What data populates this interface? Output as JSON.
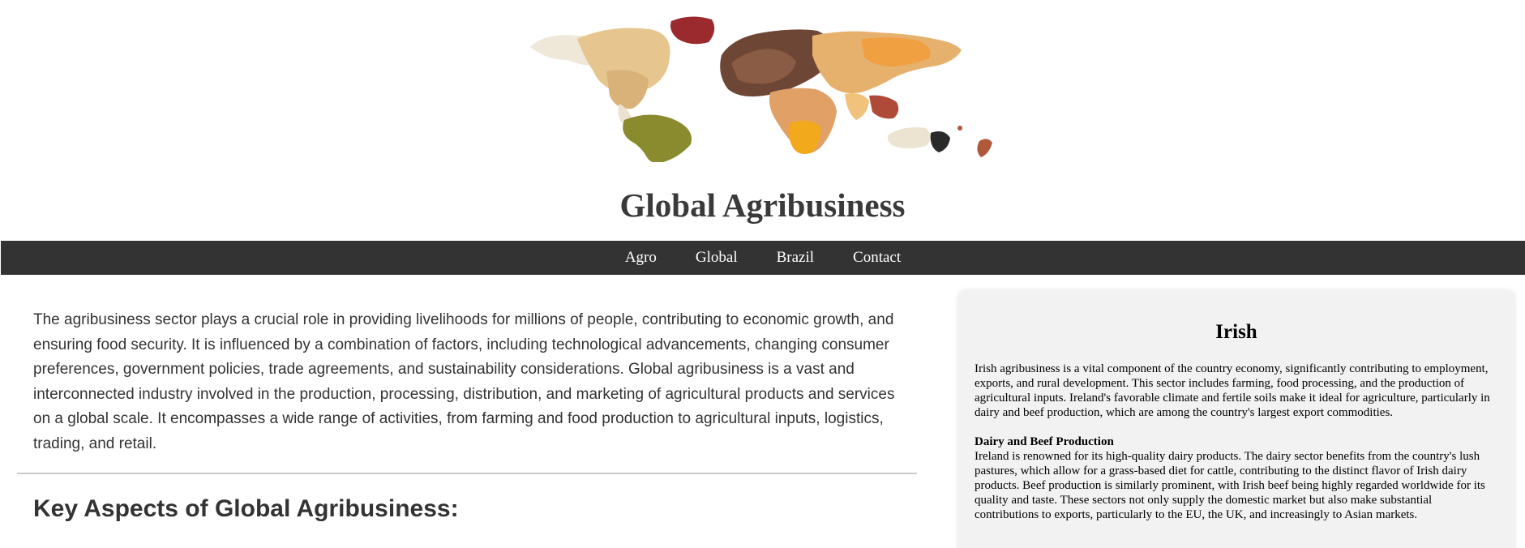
{
  "header": {
    "logo_icon": "world-map-of-seeds-logo",
    "title": "Global Agribusiness"
  },
  "nav": {
    "items": [
      {
        "label": "Agro"
      },
      {
        "label": "Global"
      },
      {
        "label": "Brazil"
      },
      {
        "label": "Contact"
      }
    ]
  },
  "main": {
    "intro": "The agribusiness sector plays a crucial role in providing livelihoods for millions of people, contributing to economic growth, and ensuring food security. It is influenced by a combination of factors, including technological advancements, changing consumer preferences, government policies, trade agreements, and sustainability considerations. Global agribusiness is a vast and interconnected industry involved in the production, processing, distribution, and marketing of agricultural products and services on a global scale. It encompasses a wide range of activities, from farming and food production to agricultural inputs, logistics, trading, and retail.",
    "section_heading": "Key Aspects of Global Agribusiness:"
  },
  "sidebar": {
    "title": "Irish",
    "paragraph1": "Irish agribusiness is a vital component of the country economy, significantly contributing to employment, exports, and rural development. This sector includes farming, food processing, and the production of agricultural inputs. Ireland's favorable climate and fertile soils make it ideal for agriculture, particularly in dairy and beef production, which are among the country's largest export commodities.",
    "subheading": "Dairy and Beef Production",
    "paragraph2": "Ireland is renowned for its high-quality dairy products. The dairy sector benefits from the country's lush pastures, which allow for a grass-based diet for cattle, contributing to the distinct flavor of Irish dairy products. Beef production is similarly prominent, with Irish beef being highly regarded worldwide for its quality and taste. These sectors not only supply the domestic market but also make substantial contributions to exports, particularly to the EU, the UK, and increasingly to Asian markets."
  },
  "colors": {
    "navbar_bg": "#333333",
    "nav_text": "#ffffff",
    "sidebar_bg": "#f2f2f2",
    "body_text": "#333333"
  }
}
